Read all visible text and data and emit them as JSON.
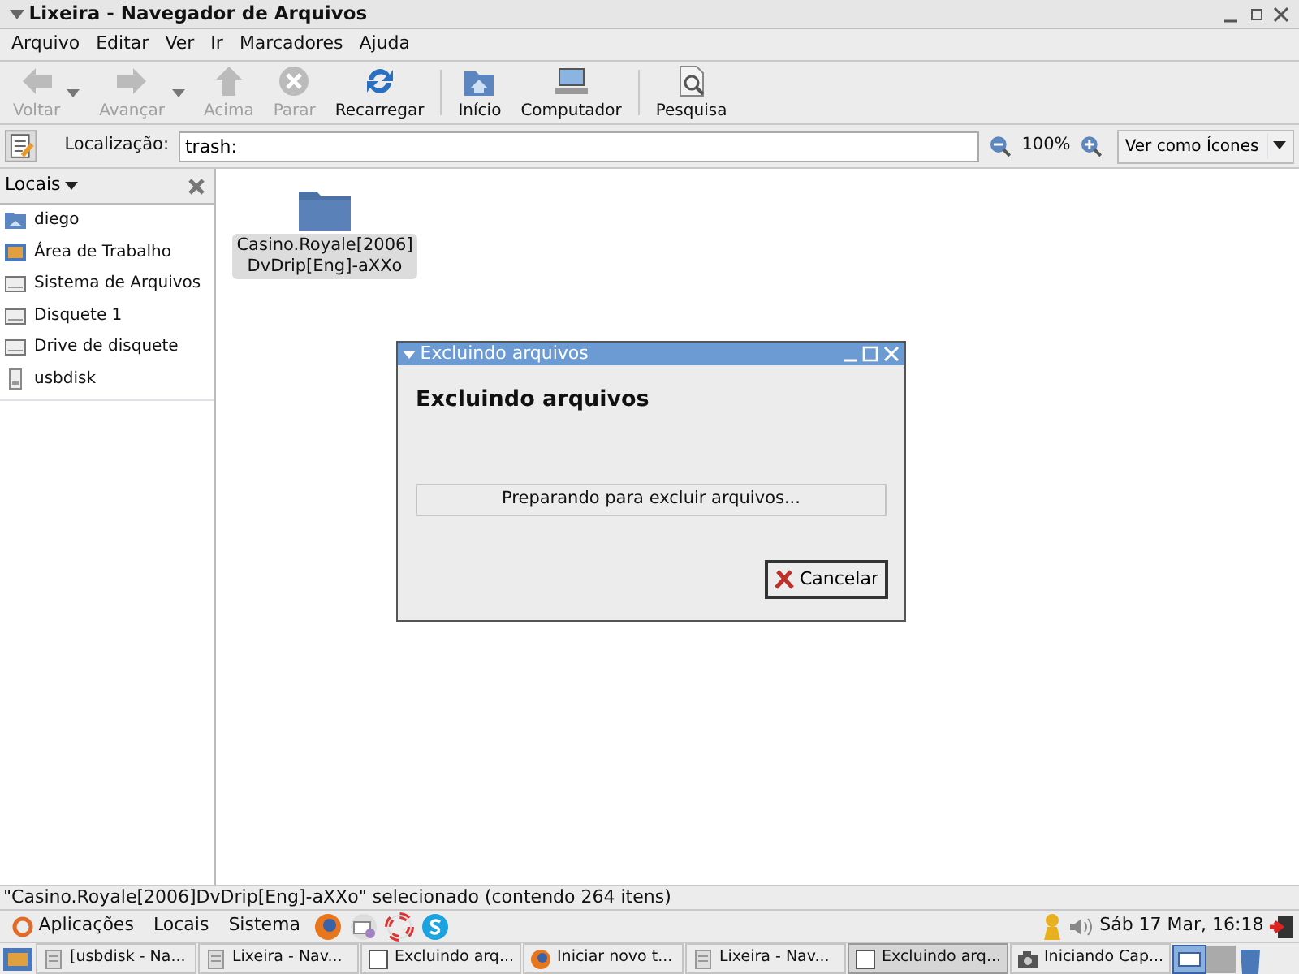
{
  "window": {
    "title": "Lixeira - Navegador de Arquivos"
  },
  "menu": [
    "Arquivo",
    "Editar",
    "Ver",
    "Ir",
    "Marcadores",
    "Ajuda"
  ],
  "toolbar": [
    {
      "label": "Voltar",
      "kind": "back",
      "disabled": true,
      "dropdown": true
    },
    {
      "label": "Avançar",
      "kind": "forward",
      "disabled": true,
      "dropdown": true
    },
    {
      "label": "Acima",
      "kind": "up",
      "disabled": true,
      "dropdown": false
    },
    {
      "label": "Parar",
      "kind": "stop",
      "disabled": true,
      "dropdown": false
    },
    {
      "label": "Recarregar",
      "kind": "reload",
      "disabled": false,
      "dropdown": false
    },
    {
      "label": "Início",
      "kind": "home",
      "disabled": false,
      "dropdown": false
    },
    {
      "label": "Computador",
      "kind": "computer",
      "disabled": false,
      "dropdown": false
    },
    {
      "label": "Pesquisa",
      "kind": "search",
      "disabled": false,
      "dropdown": false
    }
  ],
  "location": {
    "label": "Localização:",
    "value": "trash:",
    "zoom": "100%",
    "view": "Ver como Ícones"
  },
  "sidebar": {
    "title": "Locais",
    "items": [
      {
        "label": "diego",
        "kind": "home"
      },
      {
        "label": "Área de Trabalho",
        "kind": "desktop"
      },
      {
        "label": "Sistema de Arquivos",
        "kind": "drive"
      },
      {
        "label": "Disquete 1",
        "kind": "drive"
      },
      {
        "label": "Drive de disquete",
        "kind": "drive"
      },
      {
        "label": "usbdisk",
        "kind": "usb"
      }
    ]
  },
  "files": [
    {
      "name": "Casino.Royale[2006]\nDvDrip[Eng]-aXXo",
      "selected": true
    }
  ],
  "dialog": {
    "title": "Excluindo arquivos",
    "heading": "Excluindo arquivos",
    "progress_text": "Preparando para excluir arquivos...",
    "level": 0,
    "button": "Cancelar"
  },
  "status_bar": "\"Casino.Royale[2006]DvDrip[Eng]-aXXo\" selecionado (contendo 264 itens)",
  "panel": {
    "menus": [
      "Aplicações",
      "Locais",
      "Sistema"
    ],
    "clock": "Sáb 17 Mar, 16:18"
  },
  "taskbar": [
    {
      "label": "[usbdisk - Na...",
      "kind": "folder",
      "selected": false
    },
    {
      "label": "Lixeira - Nav...",
      "kind": "folder",
      "selected": false
    },
    {
      "label": "Excluindo arq...",
      "kind": "window",
      "selected": false
    },
    {
      "label": "Iniciar novo t...",
      "kind": "browser",
      "selected": false
    },
    {
      "label": "Lixeira - Nav...",
      "kind": "folder",
      "selected": false
    },
    {
      "label": "Excluindo arq...",
      "kind": "window",
      "selected": true
    },
    {
      "label": "Iniciando Cap...",
      "kind": "camera",
      "selected": false
    }
  ]
}
